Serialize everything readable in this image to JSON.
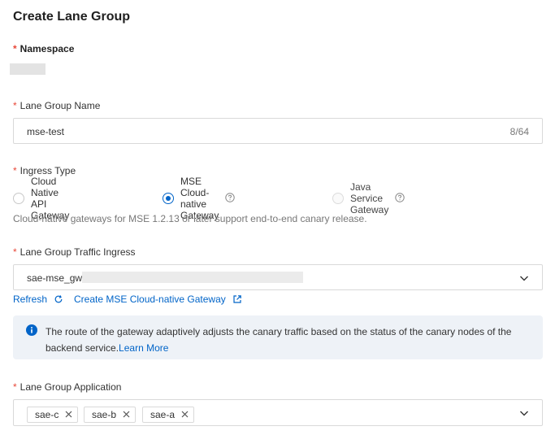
{
  "title": "Create Lane Group",
  "namespace": {
    "label": "Namespace"
  },
  "lane_group_name": {
    "label": "Lane Group Name",
    "value": "mse-test",
    "counter": "8/64"
  },
  "ingress_type": {
    "label": "Ingress Type",
    "options": [
      {
        "label": "Cloud Native API Gateway",
        "selected": false
      },
      {
        "label": "MSE Cloud-native Gateway",
        "selected": true
      },
      {
        "label": "Java Service Gateway",
        "selected": false,
        "disabled": true
      }
    ],
    "hint": "Cloud-native gateways for MSE 1.2.13 or later support end-to-end canary release."
  },
  "traffic_ingress": {
    "label": "Lane Group Traffic Ingress",
    "value": "sae-mse_gw",
    "refresh_label": "Refresh",
    "create_label": "Create MSE Cloud-native Gateway"
  },
  "notice": {
    "text": "The route of the gateway adaptively adjusts the canary traffic based on the status of the canary nodes of the backend service.",
    "link": "Learn More"
  },
  "application": {
    "label": "Lane Group Application",
    "tags": [
      "sae-c",
      "sae-b",
      "sae-a"
    ]
  },
  "colors": {
    "accent": "#0064c8",
    "required": "#e84738",
    "notice_bg": "#eef2f7"
  }
}
